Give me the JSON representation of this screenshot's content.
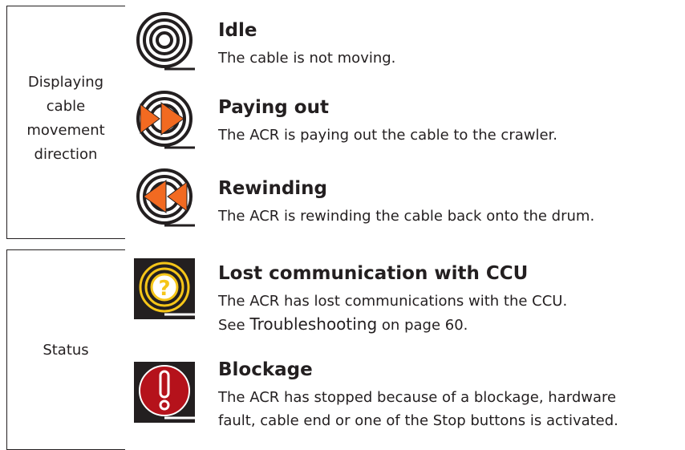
{
  "sections": [
    {
      "label_lines": [
        "Displaying",
        "cable",
        "movement",
        "direction"
      ],
      "items": [
        {
          "icon": "idle-drum-icon",
          "title": "Idle",
          "description": [
            "The cable is not moving."
          ]
        },
        {
          "icon": "paying-out-icon",
          "title": "Paying out",
          "description": [
            "The ACR is paying out the cable to the crawler."
          ]
        },
        {
          "icon": "rewinding-icon",
          "title": "Rewinding",
          "description": [
            "The ACR is rewinding the cable back onto the drum."
          ]
        }
      ]
    },
    {
      "label_lines": [
        "Status"
      ],
      "items": [
        {
          "icon": "lost-communication-icon",
          "title": "Lost communication with CCU",
          "description": [
            "The ACR has lost communications with the CCU."
          ],
          "see": "See",
          "link": "Troubleshooting",
          "page_ref": "on page 60."
        },
        {
          "icon": "blockage-icon",
          "title": "Blockage",
          "description": [
            "The ACR has stopped because of a blockage, hardware",
            "fault, cable end or one of the Stop buttons is activated."
          ]
        }
      ]
    }
  ],
  "colors": {
    "orange": "#f26a21",
    "yellow": "#f5c518",
    "red": "#b5121b",
    "ink": "#231f20"
  }
}
